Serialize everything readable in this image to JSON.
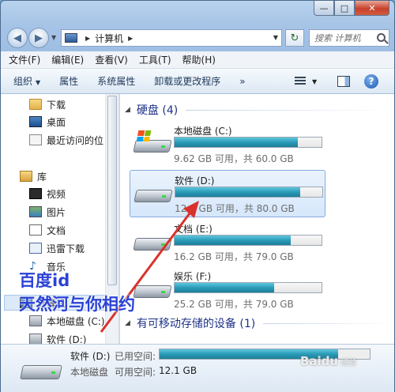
{
  "window": {
    "minimize": "—",
    "maximize": "□",
    "close": "✕"
  },
  "address": {
    "location": "计算机",
    "search_placeholder": "搜索 计算机"
  },
  "menu": [
    "文件(F)",
    "编辑(E)",
    "查看(V)",
    "工具(T)",
    "帮助(H)"
  ],
  "toolbar": {
    "organize": "组织",
    "properties": "属性",
    "system_properties": "系统属性",
    "uninstall": "卸载或更改程序",
    "more": "»"
  },
  "nav": {
    "items": [
      "下载",
      "桌面",
      "最近访问的位",
      "库",
      "视频",
      "图片",
      "文档",
      "迅雷下载",
      "音乐",
      "计算机",
      "本地磁盘 (C:)",
      "软件 (D:)"
    ]
  },
  "content": {
    "hard_disks_header": "硬盘 (4)",
    "removable_header": "有可移动存储的设备 (1)",
    "drives": [
      {
        "name": "本地磁盘 (C:)",
        "free": "9.62 GB 可用，共 60.0 GB",
        "used_fraction": 0.84
      },
      {
        "name": "软件 (D:)",
        "free": "12.1 GB 可用，共 80.0 GB",
        "used_fraction": 0.85
      },
      {
        "name": "文档 (E:)",
        "free": "16.2 GB 可用，共 79.0 GB",
        "used_fraction": 0.79
      },
      {
        "name": "娱乐 (F:)",
        "free": "25.2 GB 可用，共 79.0 GB",
        "used_fraction": 0.68
      }
    ]
  },
  "details": {
    "name": "软件 (D:)",
    "used_label": "已用空间:",
    "type": "本地磁盘",
    "free_label": "可用空间:",
    "free_value": "12.1 GB",
    "used_fraction": 0.85
  },
  "overlay": {
    "watermark_line1": "百度id",
    "watermark_line2": "天然河与你相约",
    "baidu_logo": "Baidu",
    "baidu_logo_sub": "经验"
  },
  "colors": {
    "bar_fill": "#2a9bb8",
    "header_text": "#1e3287",
    "watermark": "#2b42d6",
    "arrow": "#d9322c"
  }
}
